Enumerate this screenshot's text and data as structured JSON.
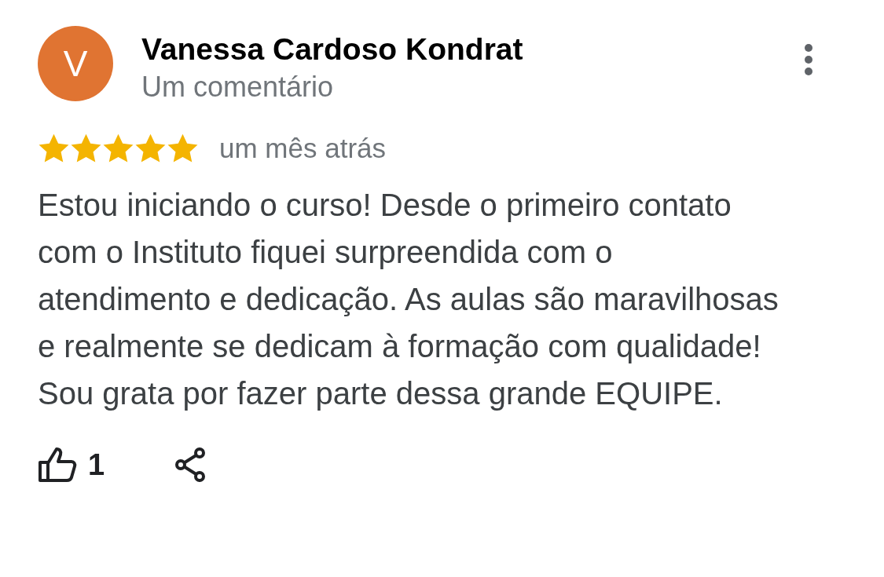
{
  "review": {
    "avatar_letter": "V",
    "author": "Vanessa Cardoso Kondrat",
    "author_subtitle": "Um comentário",
    "stars": 5,
    "time": "um mês atrás",
    "text": "Estou iniciando o curso! Desde o primeiro contato com o Instituto fiquei surpreendida com o atendimento e dedicação. As aulas são maravilhosas e realmente se dedicam à formação com qualidade! Sou grata por fazer parte dessa grande EQUIPE.",
    "like_count": "1"
  }
}
